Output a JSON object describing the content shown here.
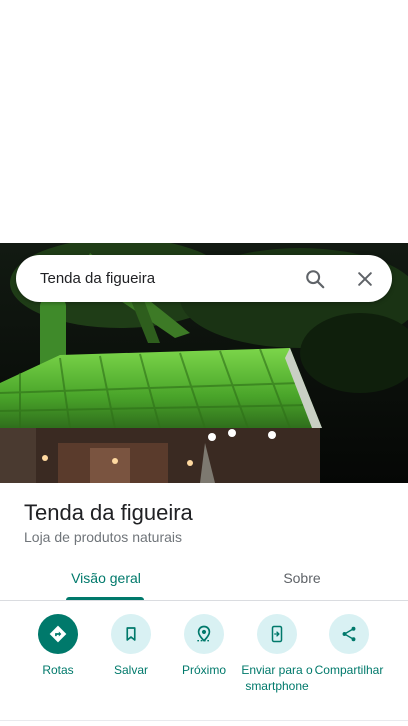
{
  "search": {
    "query": "Tenda da figueira"
  },
  "place": {
    "name": "Tenda da figueira",
    "category": "Loja de produtos naturais"
  },
  "tabs": [
    {
      "label": "Visão geral",
      "active": true
    },
    {
      "label": "Sobre",
      "active": false
    }
  ],
  "actions": [
    {
      "label": "Rotas",
      "icon": "directions-icon"
    },
    {
      "label": "Salvar",
      "icon": "bookmark-icon"
    },
    {
      "label": "Próximo",
      "icon": "nearby-icon"
    },
    {
      "label": "Enviar para o smartphone",
      "icon": "send-to-phone-icon"
    },
    {
      "label": "Compartilhar",
      "icon": "share-icon"
    }
  ],
  "colors": {
    "accent": "#00796b",
    "action_bg": "#d9f1f3",
    "secondary_text": "#70757a"
  }
}
